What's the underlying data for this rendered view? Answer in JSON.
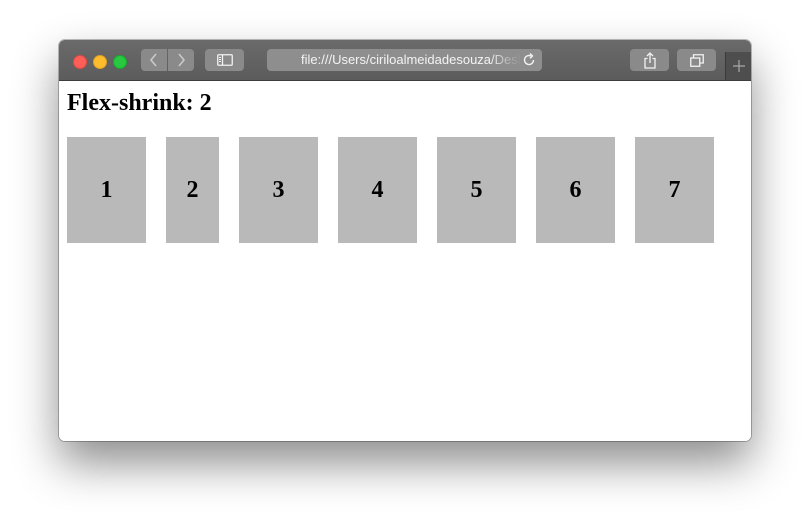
{
  "browser": {
    "url": "file:///Users/ciriloalmeidadesouza/Desktop/flex-shrink.html",
    "colors": {
      "close": "#fc5f57",
      "minimize": "#fdbc2e",
      "maximize": "#28c840"
    },
    "icons": {
      "back": "chevron-left-icon",
      "forward": "chevron-right-icon",
      "sidebar": "sidebar-icon",
      "reload": "reload-icon",
      "share": "share-icon",
      "tabs": "tabs-icon",
      "new_tab": "plus-icon"
    }
  },
  "page": {
    "heading": "Flex-shrink: 2",
    "items": [
      {
        "label": "1"
      },
      {
        "label": "2"
      },
      {
        "label": "3"
      },
      {
        "label": "4"
      },
      {
        "label": "5"
      },
      {
        "label": "6"
      },
      {
        "label": "7"
      }
    ],
    "item_color": "#b9b9b9"
  }
}
